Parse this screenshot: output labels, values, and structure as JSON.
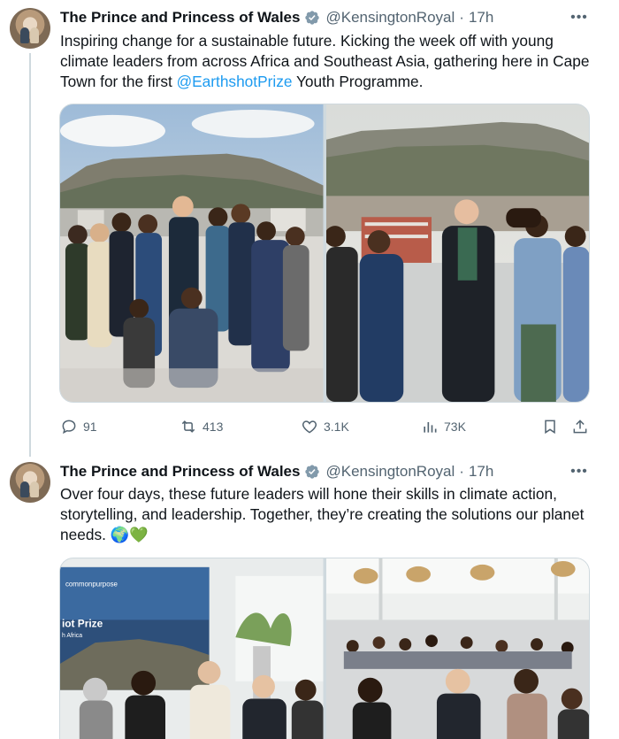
{
  "tweets": [
    {
      "author": {
        "display_name": "The Prince and Princess of Wales",
        "handle": "@KensingtonRoyal",
        "time": "17h",
        "verified_color": "#829aab"
      },
      "text": {
        "before_link": "Inspiring change for a sustainable future. Kicking the week off with young climate leaders from across Africa and Southeast Asia, gathering here in Cape Town for the first ",
        "link": "@EarthshotPrize",
        "after_link": " Youth Programme."
      },
      "media_icons": [
        "group-photo-table-mountain",
        "prince-william-with-young-leaders"
      ],
      "actions": {
        "replies": "91",
        "reposts": "413",
        "likes": "3.1K",
        "views": "73K"
      }
    },
    {
      "author": {
        "display_name": "The Prince and Princess of Wales",
        "handle": "@KensingtonRoyal",
        "time": "17h"
      },
      "text": {
        "body": "Over four days, these future leaders will hone their skills in climate action, storytelling, and leadership. Together, they’re creating the solutions our planet needs. 🌍💚"
      },
      "media": {
        "screen_brand": "commonpurpose",
        "screen_title": "iot Prize",
        "screen_sub": "h Africa"
      }
    }
  ],
  "colors": {
    "link": "#1d9bf0",
    "secondary_text": "#536471",
    "primary_text": "#0f1419"
  }
}
